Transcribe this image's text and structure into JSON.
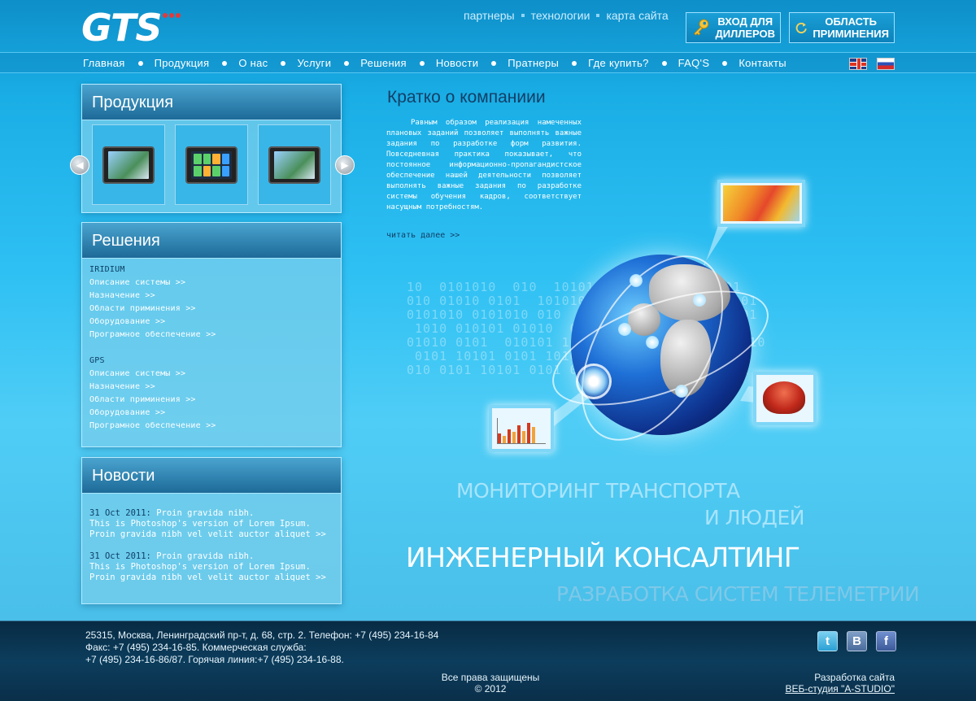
{
  "header": {
    "logo_text": "GTS",
    "top_links": [
      "партнеры",
      "технологии",
      "карта сайта"
    ],
    "dealers_button": "ВХОД ДЛЯ ДИЛЛЕРОВ",
    "area_button": "ОБЛАСТЬ ПРИМИНЕНИЯ"
  },
  "nav": {
    "items": [
      "Главная",
      "Продукция",
      "О нас",
      "Услуги",
      "Решения",
      "Новости",
      "Пратнеры",
      "Где купить?",
      "FAQ'S",
      "Контакты"
    ],
    "flags": [
      "flag-uk-icon",
      "flag-ru-icon"
    ]
  },
  "products": {
    "title": "Продукция"
  },
  "solutions": {
    "title": "Решения",
    "groups": [
      {
        "name": "IRIDIUM",
        "links": [
          "Описание системы >>",
          "Назначение >>",
          "Области приминения >>",
          "Оборудование >>",
          "Програмное обеспечение >>"
        ]
      },
      {
        "name": "GPS",
        "links": [
          "Описание системы >>",
          "Назначение >>",
          "Области приминения >>",
          "Оборудование >>",
          "Програмное обеспечение >>"
        ]
      }
    ]
  },
  "news": {
    "title": "Новости",
    "items": [
      {
        "date": "31 Oct 2011:",
        "headline": "Proin gravida nibh.",
        "text": "This is Photoshop's version  of Lorem Ipsum. Proin gravida nibh vel velit auctor aliquet >>"
      },
      {
        "date": "31 Oct 2011:",
        "headline": "Proin gravida nibh.",
        "text": "This is Photoshop's version  of Lorem Ipsum. Proin gravida nibh vel velit auctor aliquet >>"
      }
    ]
  },
  "about": {
    "title": "Кратко о компаниии",
    "text": "Равным образом реализация намеченных плановых заданий позволяет выполнять важные задания по разработке форм развития. Повседневная практика показывает, что постоянное информационно-пропагандистское обеспечение нашей деятельности позволяет выполнять важные задания по разработке системы обучения кадров, соответствует насущным потребностям.",
    "read_more": "читать далее >>"
  },
  "hero": {
    "binary": "10  0101010  010  10101 0101  010101 0101\n010 01010 0101  101010 1010 01010101 010101\n0101010 0101010 010  10101 010 1010101 0101\n 1010 010101 01010  010 1010 010101  01010\n01010 0101  010101 10101  0101 01010 0101010\n 0101 10101 0101 1010  1010 0101 010101 01\n010 0101 10101 0101 0101 0101 01010 010101"
  },
  "taglines": {
    "line1": "МОНИТОРИНГ ТРАНСПОРТА",
    "line2": "И ЛЮДЕЙ",
    "line3": "ИНЖЕНЕРНЫЙ КОНСАЛТИНГ",
    "line4": "РАЗРАБОТКА СИСТЕМ ТЕЛЕМЕТРИИ"
  },
  "footer": {
    "address_1": "25315, Москва, Ленинградский пр-т, д. 68, стр. 2. Телефон: +7 (495) 234-16-84",
    "address_2": "Факс: +7 (495) 234-16-85. Коммерческая служба:",
    "address_3": "+7 (495) 234-16-86/87. Горячая линия:+7 (495) 234-16-88.",
    "rights": "Все права защищены",
    "year": "© 2012",
    "dev_label": "Разработка сайта",
    "dev_link": "ВЕБ-студия \"A-STUDIO\"",
    "social": [
      "twitter-icon",
      "vkontakte-icon",
      "facebook-icon"
    ]
  }
}
